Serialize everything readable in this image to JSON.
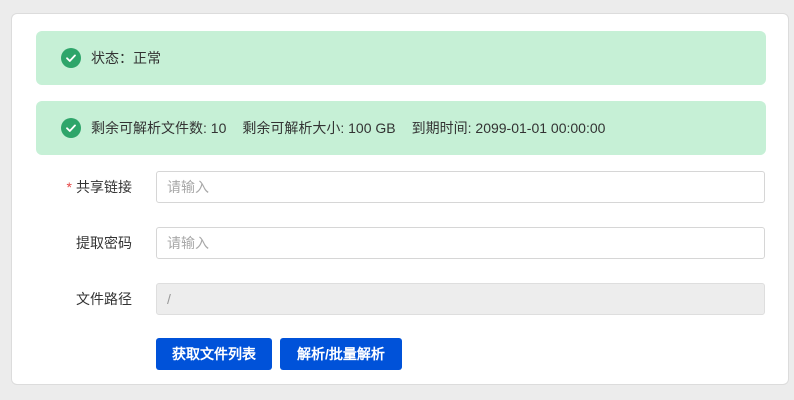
{
  "alerts": {
    "status": {
      "icon": "check-circle-icon",
      "text": "状态：正常"
    },
    "quota": {
      "icon": "check-circle-icon",
      "files_remaining": "剩余可解析文件数: 10",
      "size_remaining": "剩余可解析大小: 100 GB",
      "expiry": "到期时间: 2099-01-01 00:00:00"
    }
  },
  "form": {
    "share_link": {
      "required_mark": "*",
      "label": "共享链接",
      "placeholder": "请输入",
      "value": ""
    },
    "extract_code": {
      "label": "提取密码",
      "placeholder": "请输入",
      "value": ""
    },
    "file_path": {
      "label": "文件路径",
      "value": "/"
    }
  },
  "buttons": {
    "get_file_list": "获取文件列表",
    "parse": "解析/批量解析"
  },
  "colors": {
    "alert_bg": "#c6f0d6",
    "success": "#2ea56a",
    "primary": "#0052d9",
    "required": "#e54545"
  }
}
